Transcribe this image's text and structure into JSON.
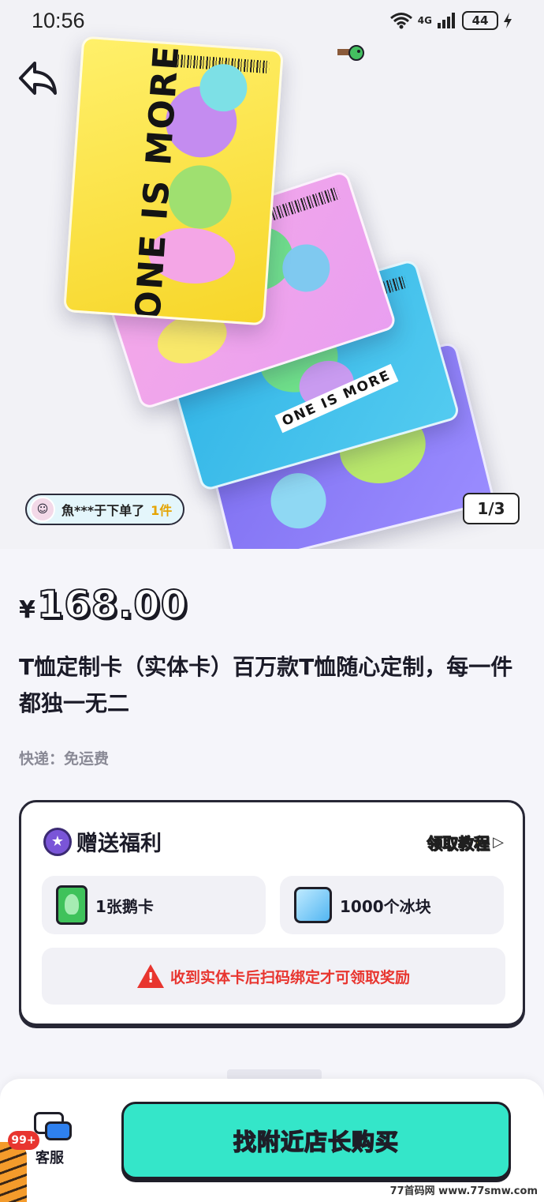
{
  "status_bar": {
    "time": "10:56",
    "network": "4G",
    "battery": "44"
  },
  "hero": {
    "card_text": "ONE IS MORE",
    "card_text_small": "ONE IS MORE",
    "recent_order": {
      "text": "魚***于下单了",
      "qty": "1件"
    },
    "image_counter": "1/3"
  },
  "product": {
    "currency": "¥",
    "price": "168.00",
    "title": "T恤定制卡（实体卡）百万款T恤随心定制，每一件都独一无二",
    "shipping": "快递：免运费"
  },
  "benefits": {
    "title": "赠送福利",
    "tutorial_label": "领取教程",
    "rewards": [
      {
        "label": "1张鹅卡",
        "icon": "penguin-card-icon"
      },
      {
        "label": "1000个冰块",
        "icon": "ice-cube-icon"
      }
    ],
    "warning": "收到实体卡后扫码绑定才可领取奖励"
  },
  "bottom_bar": {
    "service_label": "客服",
    "badge": "99+",
    "buy_label": "找附近店长购买"
  },
  "watermark": "77首码网 www.77smw.com",
  "colors": {
    "accent_button": "#34e6c9",
    "warning": "#e8352f",
    "tutorial_gold": "#ffd21a",
    "medal_purple": "#7a55d8"
  }
}
